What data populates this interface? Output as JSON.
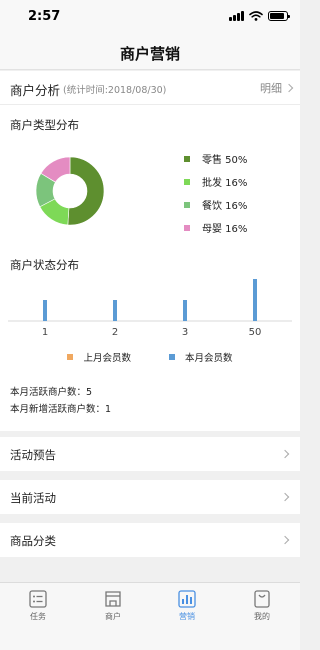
{
  "status_bar": {
    "time": "2:57"
  },
  "nav": {
    "title": "商户营销"
  },
  "analysis": {
    "title": "商户分析",
    "stat_time": "(统计时间:2018/08/30)",
    "detail_label": "明细"
  },
  "type_distribution": {
    "title": "商户类型分布",
    "legend": [
      {
        "label": "零售 50%",
        "color": "#5e8f2f"
      },
      {
        "label": "批发 16%",
        "color": "#7ed957"
      },
      {
        "label": "餐饮 16%",
        "color": "#7cc47c"
      },
      {
        "label": "母婴 16%",
        "color": "#e48cc2"
      }
    ]
  },
  "status_distribution": {
    "title": "商户状态分布",
    "legend": [
      {
        "label": "上月会员数",
        "color": "#f0a860"
      },
      {
        "label": "本月会员数",
        "color": "#5b9bd5"
      }
    ]
  },
  "stats": {
    "active_merchants": "本月活跃商户数：5",
    "new_active_merchants": "本月新增活跃商户数：1"
  },
  "menu": [
    {
      "label": "活动预告"
    },
    {
      "label": "当前活动"
    },
    {
      "label": "商品分类"
    }
  ],
  "tabs": [
    {
      "label": "任务",
      "icon": "task-icon"
    },
    {
      "label": "商户",
      "icon": "store-icon"
    },
    {
      "label": "营销",
      "icon": "bar-chart-icon",
      "active": true
    },
    {
      "label": "我的",
      "icon": "profile-icon"
    }
  ],
  "chart_data": [
    {
      "type": "pie",
      "title": "商户类型分布",
      "categories": [
        "零售",
        "批发",
        "餐饮",
        "母婴"
      ],
      "values": [
        50,
        16,
        16,
        16
      ],
      "colors": [
        "#5e8f2f",
        "#7ed957",
        "#7cc47c",
        "#e48cc2"
      ],
      "donut": true,
      "legend": "right"
    },
    {
      "type": "bar",
      "title": "商户状态分布",
      "categories": [
        "1",
        "2",
        "3",
        "50"
      ],
      "series": [
        {
          "name": "上月会员数",
          "values": [
            0,
            0,
            0,
            0
          ],
          "color": "#f0a860"
        },
        {
          "name": "本月会员数",
          "values": [
            1,
            1,
            1,
            2
          ],
          "color": "#5b9bd5"
        }
      ],
      "ylim": [
        0,
        2
      ],
      "grid": false,
      "legend": "bottom"
    }
  ]
}
